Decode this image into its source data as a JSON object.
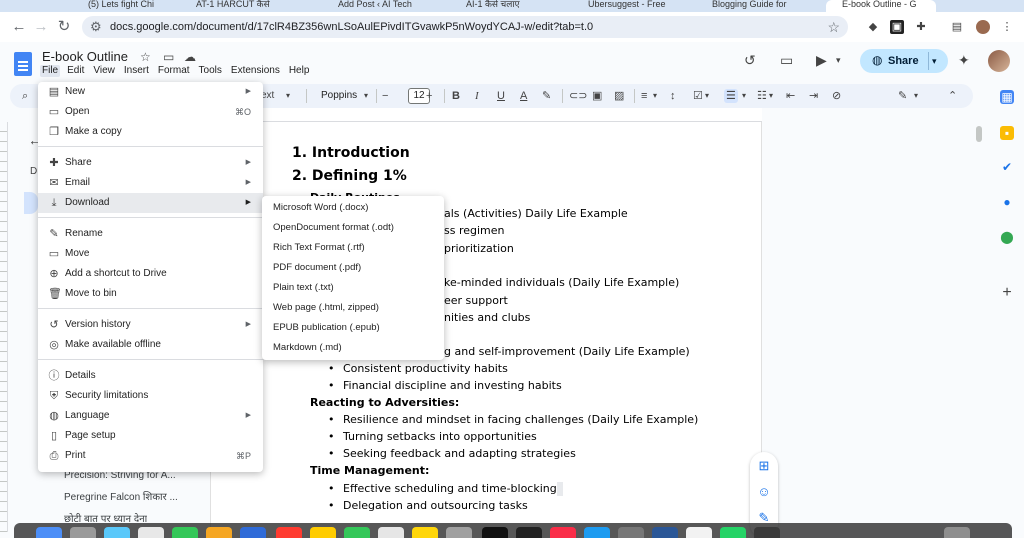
{
  "browser": {
    "tabs": [
      {
        "label": "(5) Lets fight Chi",
        "active": false
      },
      {
        "label": "AT-1 HARCUT कैसे",
        "active": false
      },
      {
        "label": "Add Post ‹ AI Tech",
        "active": false
      },
      {
        "label": "AI-1 कैसे चलाए",
        "active": false
      },
      {
        "label": "Ubersuggest - Free",
        "active": false
      },
      {
        "label": "Blogging Guide for",
        "active": false
      },
      {
        "label": "E-book Outline - G",
        "active": true
      }
    ],
    "url": "docs.google.com/document/d/17clR4BZ356wnLSoAulEPivdITGvawkP5nWoydYCAJ-w/edit?tab=t.0"
  },
  "docs": {
    "title": "E-book Outline",
    "menu": [
      "File",
      "Edit",
      "View",
      "Insert",
      "Format",
      "Tools",
      "Extensions",
      "Help"
    ],
    "share_label": "Share",
    "toolbar": {
      "style_label": "ext",
      "font": "Poppins",
      "font_size": "12"
    }
  },
  "outline_panel": {
    "tab_letter": "D",
    "items": [
      "Precision: Striving for A...",
      "Peregrine Falcon शिकार ...",
      "छोटी बात पर ध्यान देना"
    ]
  },
  "file_menu": {
    "items": [
      {
        "label": "New",
        "icon": "doc-icon",
        "shortcut": "",
        "submenu": true
      },
      {
        "label": "Open",
        "icon": "folder-icon",
        "shortcut": "⌘O",
        "submenu": false
      },
      {
        "label": "Make a copy",
        "icon": "copy-icon",
        "shortcut": "",
        "submenu": false
      },
      {
        "label": "Share",
        "icon": "person-add-icon",
        "shortcut": "",
        "submenu": true
      },
      {
        "label": "Email",
        "icon": "mail-icon",
        "shortcut": "",
        "submenu": true
      },
      {
        "label": "Download",
        "icon": "download-icon",
        "shortcut": "",
        "submenu": true
      },
      {
        "label": "Rename",
        "icon": "pencil-icon",
        "shortcut": "",
        "submenu": false
      },
      {
        "label": "Move",
        "icon": "move-folder-icon",
        "shortcut": "",
        "submenu": false
      },
      {
        "label": "Add a shortcut to Drive",
        "icon": "drive-shortcut-icon",
        "shortcut": "",
        "submenu": false
      },
      {
        "label": "Move to bin",
        "icon": "trash-icon",
        "shortcut": "",
        "submenu": false
      },
      {
        "label": "Version history",
        "icon": "history-icon",
        "shortcut": "",
        "submenu": true
      },
      {
        "label": "Make available offline",
        "icon": "offline-icon",
        "shortcut": "",
        "submenu": false
      },
      {
        "label": "Details",
        "icon": "info-icon",
        "shortcut": "",
        "submenu": false
      },
      {
        "label": "Security limitations",
        "icon": "shield-icon",
        "shortcut": "",
        "submenu": false
      },
      {
        "label": "Language",
        "icon": "globe-icon",
        "shortcut": "",
        "submenu": true
      },
      {
        "label": "Page setup",
        "icon": "page-icon",
        "shortcut": "",
        "submenu": false
      },
      {
        "label": "Print",
        "icon": "print-icon",
        "shortcut": "⌘P",
        "submenu": false
      }
    ]
  },
  "download_submenu": {
    "items": [
      "Microsoft Word (.docx)",
      "OpenDocument format (.odt)",
      "Rich Text Format (.rtf)",
      "PDF document (.pdf)",
      "Plain text (.txt)",
      "Web page (.html, zipped)",
      "EPUB publication (.epub)",
      "Markdown (.md)"
    ]
  },
  "document": {
    "h1_1": "1.  Introduction",
    "h1_2": "2.  Defining 1%",
    "h3_1": "Daily Routines",
    "l1": "als (Activities) Daily Life Example",
    "l2": "ss regimen",
    "l3": "prioritization",
    "l4": "ke-minded individuals (Daily Life Example)",
    "l5": "eer support",
    "l6": "nities and clubs",
    "l7": "g and self-improvement (Daily Life Example)",
    "l8": "Consistent productivity habits",
    "l9": "Financial discipline and investing habits",
    "h3_2": "Reacting to Adversities:",
    "l10": "Resilience and mindset in facing challenges (Daily Life Example)",
    "l11": "Turning setbacks into opportunities",
    "l12": "Seeking feedback and adapting strategies",
    "h3_3": "Time Management:",
    "l13": "Effective scheduling and time-blocking",
    "l14": "Delegation and outsourcing tasks"
  },
  "colors": {
    "accent": "#1a73e8",
    "share_bg": "#c2e7ff",
    "docs_blue": "#4285f4"
  }
}
